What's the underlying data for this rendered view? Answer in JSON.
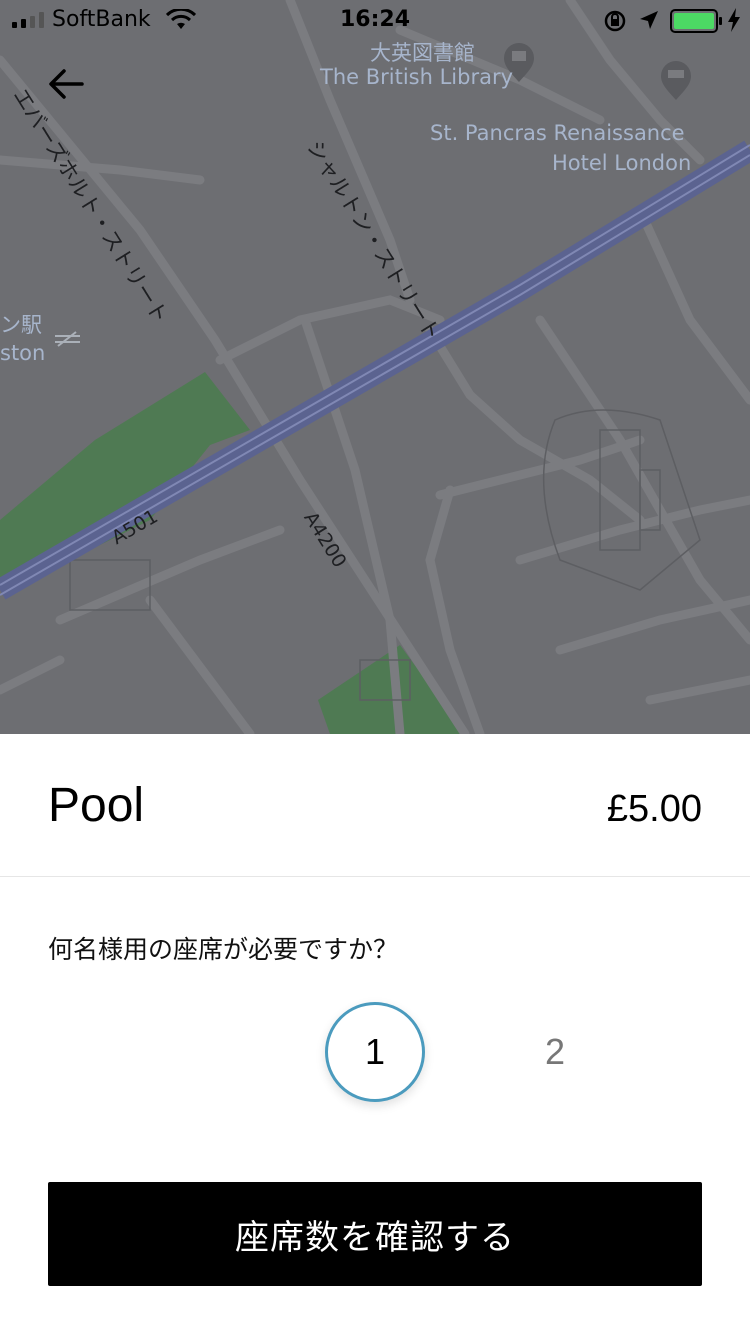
{
  "status_bar": {
    "carrier": "SoftBank",
    "time": "16:24",
    "battery_color": "#4cd964"
  },
  "map": {
    "street_labels": [
      "エバーズホルト・ストリート",
      "シャルトン・ストリート"
    ],
    "poi": {
      "british_library_ja": "大英図書館",
      "british_library_en": "The British Library",
      "st_pancras_line1": "St. Pancras Renaissance",
      "st_pancras_line2": "Hotel London",
      "station_ja": "ン駅",
      "station_en": "ston"
    },
    "road_labels": [
      "A501",
      "A4200"
    ],
    "icons": [
      "back-arrow-icon",
      "library-pin-icon",
      "hotel-pin-icon",
      "rail-icon"
    ]
  },
  "sheet": {
    "product_name": "Pool",
    "price": "£5.00",
    "question": "何名様用の座席が必要ですか？",
    "seat_options": [
      "1",
      "2"
    ],
    "selected_seat": "1",
    "accent_color": "#4b9bbe",
    "confirm_label": "座席数を確認する"
  }
}
